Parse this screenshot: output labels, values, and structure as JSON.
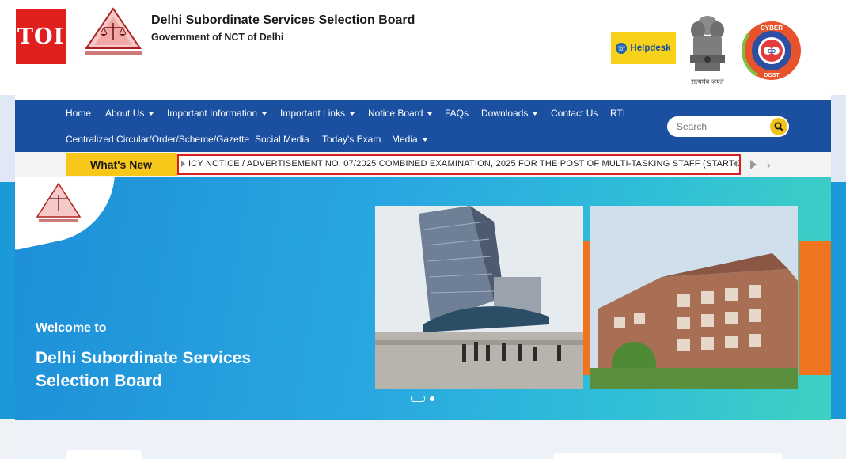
{
  "header": {
    "toi_badge": "TOI",
    "title": "Delhi Subordinate Services Selection Board",
    "subtitle": "Government of NCT of Delhi",
    "helpdesk_label": "Helpdesk",
    "emblem_caption": "सत्यमेव जयते",
    "cyber_top": "CYBER",
    "cyber_bottom": "DOST",
    "cyber_center": "CD"
  },
  "nav": {
    "row1": [
      {
        "label": "Home",
        "dropdown": false
      },
      {
        "label": "About Us",
        "dropdown": true
      },
      {
        "label": "Important Information",
        "dropdown": true
      },
      {
        "label": "Important Links",
        "dropdown": true
      },
      {
        "label": "Notice Board",
        "dropdown": true
      },
      {
        "label": "FAQs",
        "dropdown": false
      },
      {
        "label": "Downloads",
        "dropdown": true
      },
      {
        "label": "Contact Us",
        "dropdown": false
      },
      {
        "label": "RTI",
        "dropdown": false
      }
    ],
    "row2": [
      {
        "label": "Centralized Circular/Order/Scheme/Gazette",
        "dropdown": false
      },
      {
        "label": "Social Media",
        "dropdown": false
      },
      {
        "label": "Today's Exam",
        "dropdown": false
      },
      {
        "label": "Media",
        "dropdown": true
      }
    ],
    "search_placeholder": "Search"
  },
  "whats_new": {
    "label": "What's New",
    "ticker_text": "ICY NOTICE / ADVERTISEMENT NO. 07/2025 COMBINED EXAMINATION, 2025 FOR THE POST OF MULTI-TASKING STAFF (START DATE"
  },
  "banner": {
    "welcome": "Welcome to",
    "title_line1": "Delhi Subordinate Services",
    "title_line2": "Selection Board"
  },
  "colors": {
    "nav_bg": "#1b4fa0",
    "accent_yellow": "#f7c81a",
    "toi_red": "#e01f1f",
    "ticker_border": "#d81e1e",
    "banner_orange": "#f0731f"
  }
}
